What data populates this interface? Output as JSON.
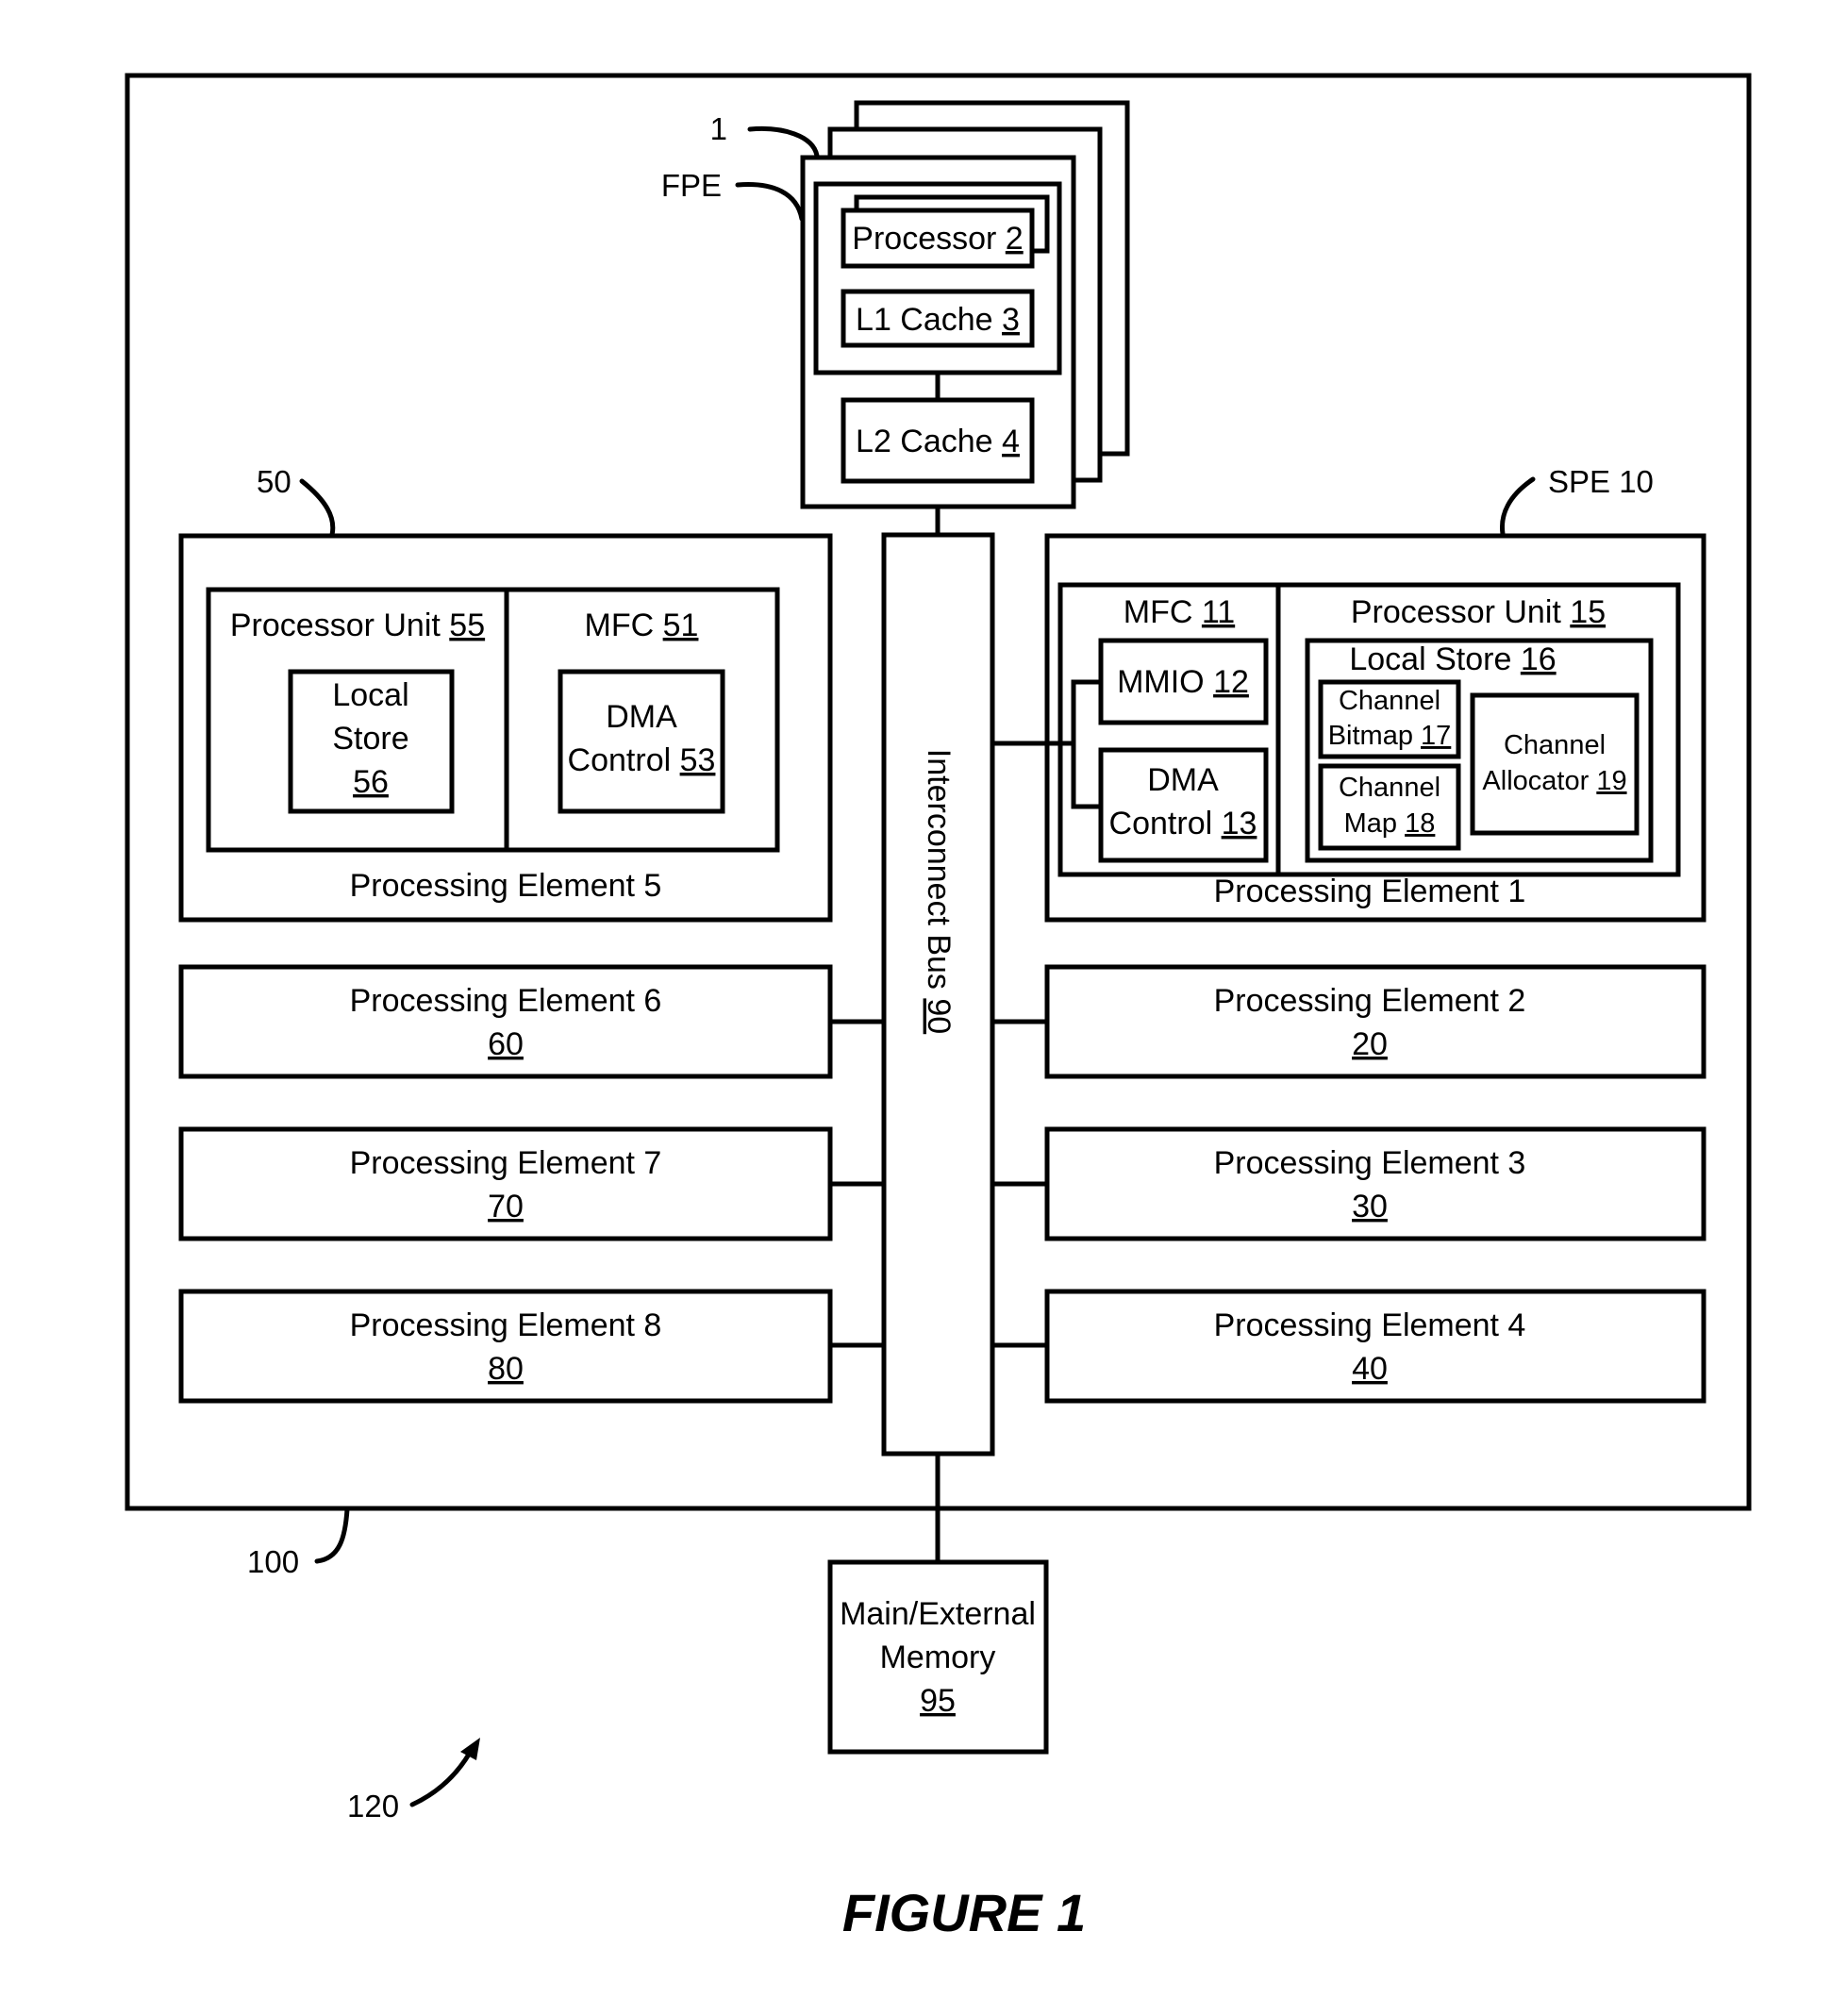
{
  "figure": {
    "title": "FIGURE 1",
    "ref_system": "120",
    "ref_chip": "100"
  },
  "fpe": {
    "ref_label": "FPE",
    "ref_number": "1",
    "processor": {
      "text": "Processor ",
      "num": "2"
    },
    "l1": {
      "text": "L1 Cache ",
      "num": "3"
    },
    "l2": {
      "text": "L2 Cache ",
      "num": "4"
    }
  },
  "pe5": {
    "ref": "50",
    "title": "Processing Element 5",
    "processor_unit": {
      "text": "Processor Unit ",
      "num": "55"
    },
    "local_store": {
      "line1": "Local",
      "line2": "Store",
      "num": "56"
    },
    "mfc": {
      "text": "MFC ",
      "num": "51"
    },
    "dma": {
      "line1": "DMA",
      "text": "Control ",
      "num": "53"
    }
  },
  "pe1": {
    "ref": "SPE 10",
    "title": "Processing Element 1",
    "mfc": {
      "text": "MFC ",
      "num": "11"
    },
    "mmio": {
      "text": "MMIO ",
      "num": "12"
    },
    "dma": {
      "line1": "DMA",
      "text": "Control ",
      "num": "13"
    },
    "processor_unit": {
      "text": "Processor Unit ",
      "num": "15"
    },
    "local_store": {
      "text": "Local Store ",
      "num": "16"
    },
    "bitmap": {
      "line1": "Channel",
      "text": "Bitmap ",
      "num": "17"
    },
    "map": {
      "line1": "Channel",
      "text": "Map ",
      "num": "18"
    },
    "allocator": {
      "line1": "Channel",
      "text": "Allocator ",
      "num": "19"
    }
  },
  "left_pes": [
    {
      "title": "Processing Element 6",
      "num": "60"
    },
    {
      "title": "Processing Element 7",
      "num": "70"
    },
    {
      "title": "Processing Element 8",
      "num": "80"
    }
  ],
  "right_pes": [
    {
      "title": "Processing Element 2",
      "num": "20"
    },
    {
      "title": "Processing Element 3",
      "num": "30"
    },
    {
      "title": "Processing Element 4",
      "num": "40"
    }
  ],
  "bus": {
    "text": "Interconnect Bus ",
    "num": "90"
  },
  "memory": {
    "line1": "Main/External",
    "line2": "Memory",
    "num": "95"
  }
}
